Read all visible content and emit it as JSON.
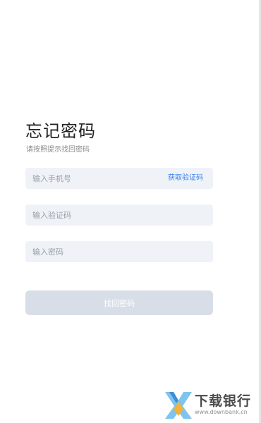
{
  "page": {
    "title": "忘记密码",
    "subtitle": "请按照提示找回密码"
  },
  "form": {
    "phone": {
      "placeholder": "输入手机号",
      "value": ""
    },
    "get_code_label": "获取验证码",
    "code": {
      "placeholder": "输入验证码",
      "value": ""
    },
    "password": {
      "placeholder": "输入密码",
      "value": ""
    },
    "submit_label": "找回密码"
  },
  "colors": {
    "accent": "#3a82f0",
    "field_bg": "#eff3f8",
    "button_disabled_bg": "#d8dee7"
  },
  "watermark": {
    "name": "下载银行",
    "url": "www.downbank.cn",
    "logo_icon": "downbank-logo-icon"
  }
}
